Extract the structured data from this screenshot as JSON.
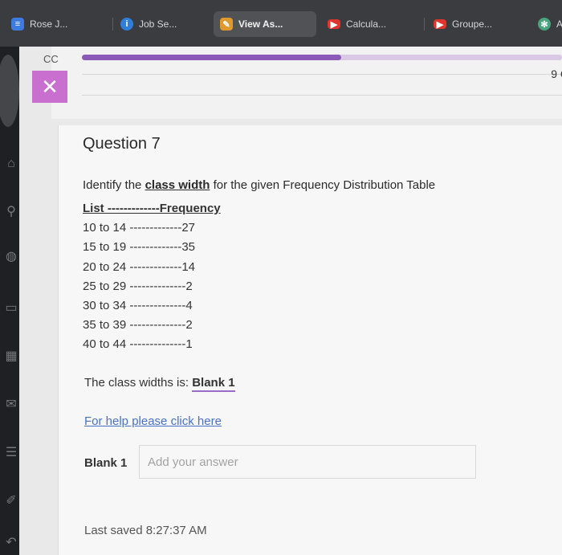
{
  "tabs": [
    {
      "label": "Rose J...",
      "icon": "list-icon",
      "color": "#3d7be0"
    },
    {
      "label": "Job Se...",
      "icon": "info-icon",
      "color": "#2f7fd8"
    },
    {
      "label": "View As...",
      "icon": "pencil-icon",
      "color": "#e09a2c"
    },
    {
      "label": "Calcula...",
      "icon": "youtube-icon",
      "color": "#e0352f"
    },
    {
      "label": "Groupe...",
      "icon": "youtube-icon",
      "color": "#e0352f"
    },
    {
      "label": "A",
      "icon": "openai-icon",
      "color": "#4aa37f"
    }
  ],
  "header": {
    "cc_text": "CC",
    "close_label": "✕",
    "counter": "9 C",
    "progress_percent": 54,
    "accent": "#8b59b8"
  },
  "question": {
    "title": "Question 7",
    "prompt_before": "Identify the ",
    "prompt_bold": "class width",
    "prompt_after": " for the given Frequency Distribution Table",
    "table_header": "List -------------Frequency",
    "rows": [
      "10 to 14 -------------27",
      "15 to 19 -------------35",
      "20 to 24 -------------14",
      "25 to 29 --------------2",
      "30 to 34 --------------4",
      "35 to 39 --------------2",
      "40 to 44 --------------1"
    ],
    "answer_prefix": "The class widths is: ",
    "blank_name": "Blank 1",
    "help_link": "For help please click here",
    "blank_label": "Blank 1",
    "input_placeholder": "Add your answer",
    "input_value": "",
    "last_saved": "Last saved 8:27:37 AM"
  }
}
